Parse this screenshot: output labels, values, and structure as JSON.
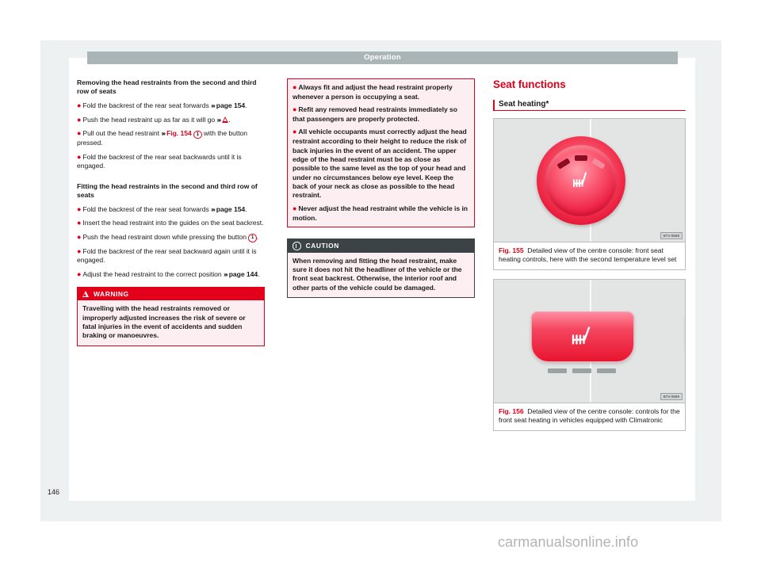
{
  "page": {
    "running_header": "Operation",
    "page_number": "146",
    "watermark": "carmanualsonline.info"
  },
  "column1": {
    "heading1": "Removing the head restraints from the second and third row of seats",
    "bullets1": [
      {
        "text_before": "Fold the backrest of the rear seat forwards ",
        "ref": "page 154",
        "text_after": "."
      },
      {
        "text_before": "Push the head restraint up as far as it will go ",
        "ref": "",
        "text_after": "."
      },
      {
        "text_before": "Pull out the head restraint ",
        "ref": "Fig. 154",
        "callout": "1",
        "text_after": " with the button pressed."
      },
      {
        "text_before": "Fold the backrest of the rear seat backwards until it is engaged.",
        "ref": "",
        "text_after": ""
      }
    ],
    "heading2": "Fitting the head restraints in the second and third row of seats",
    "bullets2": [
      {
        "text_before": "Fold the backrest of the rear seat forwards ",
        "ref": "page 154",
        "text_after": "."
      },
      {
        "text_before": "Insert the head restraint into the guides on the seat backrest.",
        "ref": "",
        "text_after": ""
      },
      {
        "text_before": "Push the head restraint down while pressing the button ",
        "callout": "1",
        "text_after": "."
      },
      {
        "text_before": "Fold the backrest of the rear seat backward again until it is engaged.",
        "ref": "",
        "text_after": ""
      },
      {
        "text_before": "Adjust the head restraint to the correct position ",
        "ref": "page 144",
        "text_after": "."
      }
    ],
    "warning_box": {
      "title": "WARNING",
      "body": "Travelling with the head restraints removed or improperly adjusted increases the risk of severe or fatal injuries in the event of accidents and sudden braking or manoeuvres."
    }
  },
  "column2": {
    "warning_continued": [
      "Always fit and adjust the head restraint properly whenever a person is occupying a seat.",
      "Refit any removed head restraints immediately so that passengers are properly protected.",
      "All vehicle occupants must correctly adjust the head restraint according to their height to reduce the risk of back injuries in the event of an accident. The upper edge of the head restraint must be as close as possible to the same level as the top of your head and under no circumstances below eye level. Keep the back of your neck as close as possible to the head restraint.",
      "Never adjust the head restraint while the vehicle is in motion."
    ],
    "caution_box": {
      "title": "CAUTION",
      "body": "When removing and fitting the head restraint, make sure it does not hit the headliner of the vehicle or the front seat backrest. Otherwise, the interior roof and other parts of the vehicle could be damaged."
    }
  },
  "column3": {
    "section_title": "Seat functions",
    "subhead": "Seat heating*",
    "figures": [
      {
        "label": "Fig. 155",
        "caption": "Detailed view of the centre console: front seat heating controls, here with the second temperature level set",
        "image_code": "B7V-0698",
        "type": "rotary-knobs",
        "levels_active": 2,
        "levels_total": 3
      },
      {
        "label": "Fig. 156",
        "caption": "Detailed view of the centre console: controls for the front seat heating in vehicles equipped with Climatronic",
        "image_code": "B7V-0699",
        "type": "rocker-buttons",
        "leds_per_button": 3
      }
    ]
  },
  "colors": {
    "accent_red": "#e2001a",
    "header_band": "#a9b5b6",
    "caution_bar": "#3c4346",
    "pink_fill": "#fdeff1"
  }
}
